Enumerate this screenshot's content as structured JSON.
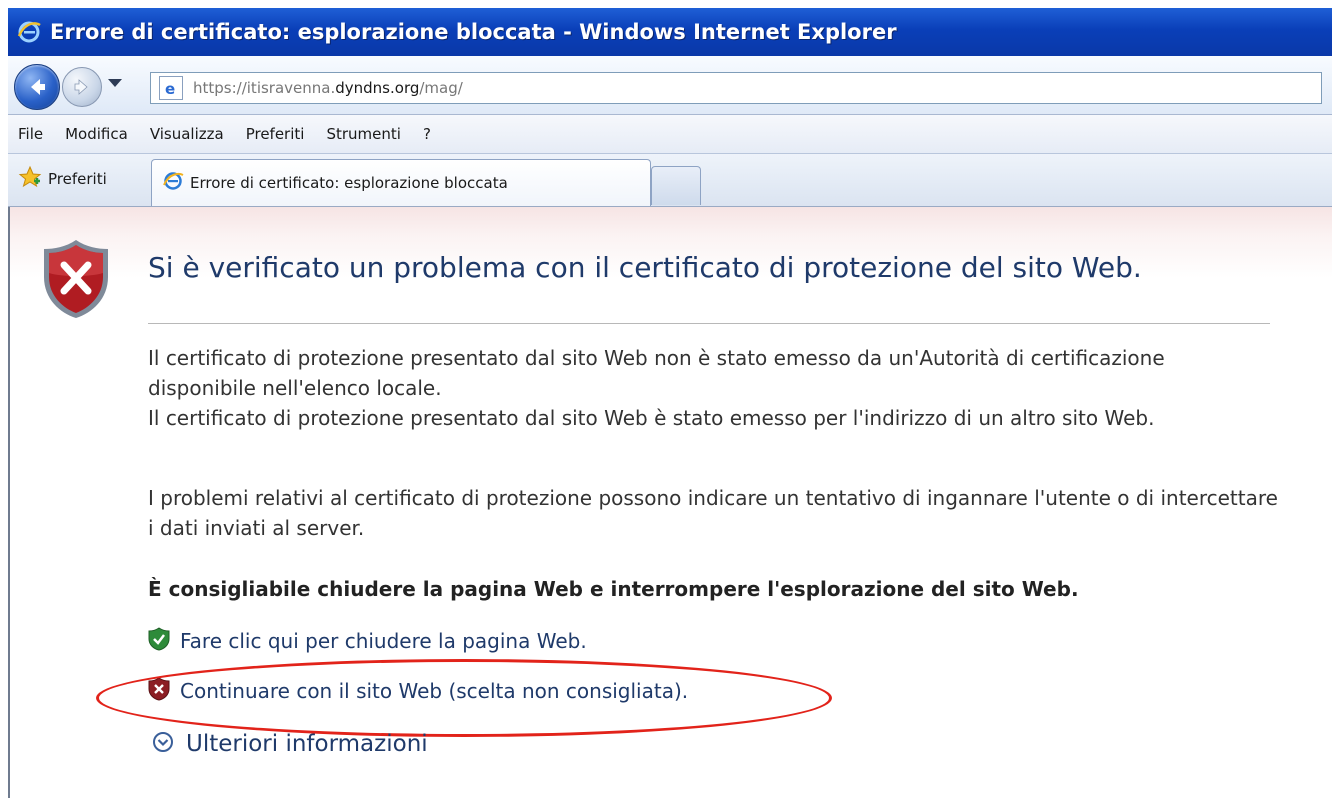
{
  "window": {
    "title": "Errore di certificato: esplorazione bloccata - Windows Internet Explorer"
  },
  "navigation": {
    "url_scheme": "https://itisravenna.",
    "url_host": "dyndns.org",
    "url_path": "/mag/"
  },
  "menu": {
    "items": [
      "File",
      "Modifica",
      "Visualizza",
      "Preferiti",
      "Strumenti",
      "?"
    ]
  },
  "favorites": {
    "label": "Preferiti"
  },
  "tab": {
    "title": "Errore di certificato: esplorazione bloccata"
  },
  "page": {
    "heading": "Si è verificato un problema con il certificato di protezione del sito Web.",
    "paragraph1": "Il certificato di protezione presentato dal sito Web non è stato emesso da un'Autorità di certificazione disponibile nell'elenco locale.",
    "paragraph2": "Il certificato di protezione presentato dal sito Web è stato emesso per l'indirizzo di un altro sito Web.",
    "paragraph3": "I problemi relativi al certificato di protezione possono indicare un tentativo di ingannare l'utente o di intercettare i dati inviati al server.",
    "recommendation": "È consigliabile chiudere la pagina Web e interrompere l'esplorazione del sito Web.",
    "close_link": "Fare clic qui per chiudere la pagina Web.",
    "continue_link": "Continuare con il sito Web (scelta non consigliata).",
    "more_info": "Ulteriori informazioni"
  },
  "colors": {
    "titlebar": "#0a3fb8",
    "heading_text": "#1f3a6a",
    "highlight": "#e2231a",
    "shield_red": "#b01c22",
    "shield_green": "#2e8b3a"
  },
  "icons": {
    "app": "ie-icon",
    "back": "back-arrow-icon",
    "forward": "forward-arrow-icon",
    "page": "ie-page-icon",
    "favorites": "star-icon",
    "error": "shield-error-icon",
    "safe": "shield-check-icon",
    "unsafe": "shield-x-icon",
    "expand": "chevron-circle-icon"
  }
}
